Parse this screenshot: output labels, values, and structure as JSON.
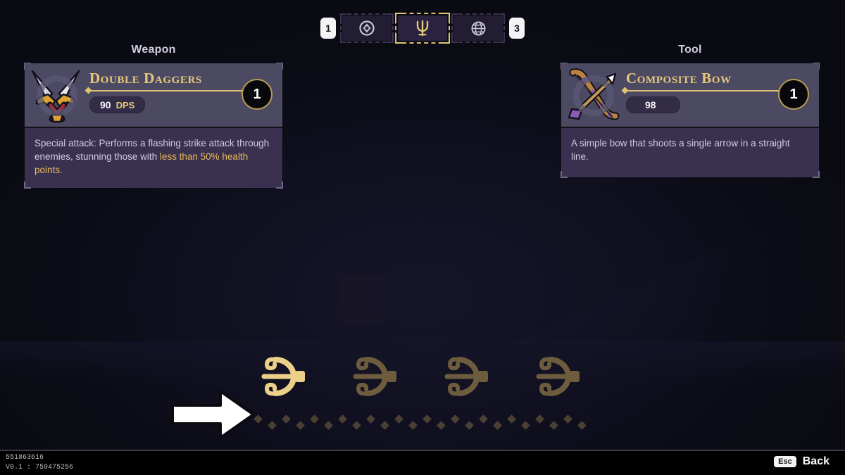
{
  "tabbar": {
    "prev_page_key": "1",
    "next_page_key": "3",
    "tabs": [
      {
        "icon": "compass-icon",
        "selected": false
      },
      {
        "icon": "trident-icon",
        "selected": true
      },
      {
        "icon": "globe-icon",
        "selected": false
      }
    ]
  },
  "weapon": {
    "section_label": "Weapon",
    "icon": "double-daggers-icon",
    "name": "Double Daggers",
    "stat_value": "90",
    "stat_unit": "DPS",
    "level": "1",
    "description_prefix": "Special attack: Performs a flashing strike attack through enemies, stunning those with ",
    "description_highlight": "less than 50% health points."
  },
  "tool": {
    "section_label": "Tool",
    "icon": "composite-bow-icon",
    "name": "Composite Bow",
    "stat_value": "98",
    "stat_unit": "",
    "level": "1",
    "description_prefix": "A simple bow that shoots a single arrow in a straight line.",
    "description_highlight": ""
  },
  "arc_slots": [
    {
      "name": "arc-slot-1",
      "state": "selected"
    },
    {
      "name": "arc-slot-2",
      "state": "locked"
    },
    {
      "name": "arc-slot-3",
      "state": "locked"
    },
    {
      "name": "arc-slot-4",
      "state": "locked"
    }
  ],
  "cursor": {
    "icon": "arrow-right-cursor"
  },
  "footer": {
    "build_id": "551863616",
    "version_line": "V0.1 : 759475256",
    "back_key": "Esc",
    "back_label": "Back"
  },
  "colors": {
    "gold": "#e6c978",
    "gold_dim": "#7a6a45",
    "card_head_bg": "#4c4963",
    "card_desc_bg": "#3a3150",
    "background": "#0d0d14",
    "highlight_text": "#e6b959"
  }
}
